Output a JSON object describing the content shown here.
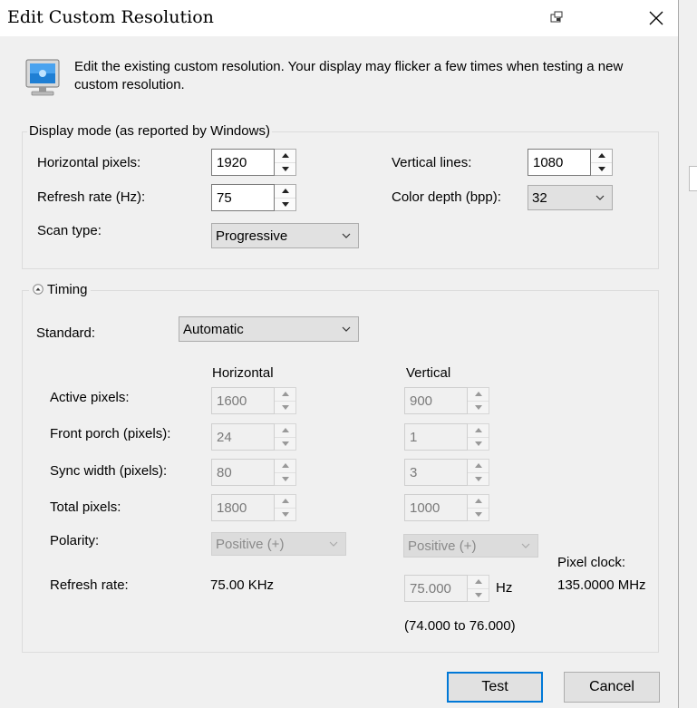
{
  "window": {
    "title": "Edit Custom Resolution"
  },
  "info": {
    "text": "Edit the existing custom resolution. Your display may flicker a few times when testing a new custom resolution."
  },
  "display_mode": {
    "legend": "Display mode (as reported by Windows)",
    "horizontal_pixels": {
      "label": "Horizontal pixels:",
      "value": "1920"
    },
    "vertical_lines": {
      "label": "Vertical lines:",
      "value": "1080"
    },
    "refresh_rate": {
      "label": "Refresh rate (Hz):",
      "value": "75"
    },
    "color_depth": {
      "label": "Color depth (bpp):",
      "value": "32"
    },
    "scan_type": {
      "label": "Scan type:",
      "value": "Progressive"
    }
  },
  "timing": {
    "legend": "Timing",
    "standard": {
      "label": "Standard:",
      "value": "Automatic"
    },
    "col_horizontal": "Horizontal",
    "col_vertical": "Vertical",
    "rows": {
      "active": {
        "label": "Active pixels:",
        "h": "1600",
        "v": "900"
      },
      "front_porch": {
        "label": "Front porch (pixels):",
        "h": "24",
        "v": "1"
      },
      "sync_width": {
        "label": "Sync width (pixels):",
        "h": "80",
        "v": "3"
      },
      "total": {
        "label": "Total pixels:",
        "h": "1800",
        "v": "1000"
      }
    },
    "polarity": {
      "label": "Polarity:",
      "h": "Positive (+)",
      "v": "Positive (+)"
    },
    "refresh": {
      "label": "Refresh rate:",
      "h": "75.00 KHz",
      "v": "75.000",
      "unit": "Hz",
      "range": "(74.000 to 76.000)"
    },
    "pixel_clock": {
      "label": "Pixel clock:",
      "value": "135.0000 MHz"
    }
  },
  "buttons": {
    "test": "Test",
    "cancel": "Cancel"
  },
  "icons": {
    "monitor": "monitor-icon",
    "collapse": "collapse-icon",
    "close": "close-icon"
  },
  "colors": {
    "accent": "#0078d7",
    "dialog_bg": "#f0f0f0"
  }
}
